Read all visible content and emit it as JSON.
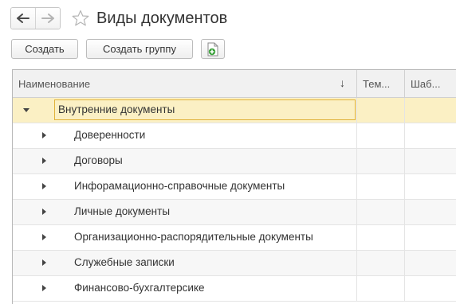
{
  "header": {
    "title": "Виды документов",
    "back_icon": "arrow-left-icon",
    "forward_icon": "arrow-right-icon",
    "favorite_icon": "star-outline-icon"
  },
  "toolbar": {
    "create_label": "Создать",
    "create_group_label": "Создать группу",
    "add_icon": "document-add-icon"
  },
  "table": {
    "columns": {
      "name": "Наименование",
      "tem": "Тем...",
      "shab": "Шаб..."
    },
    "sort_indicator": "↓",
    "root": {
      "label": "Внутренние документы",
      "expanded": true
    },
    "rows": [
      {
        "label": "Доверенности",
        "expanded": false
      },
      {
        "label": "Договоры",
        "expanded": false
      },
      {
        "label": "Инфорамационно-справочные документы",
        "expanded": false
      },
      {
        "label": "Личные документы",
        "expanded": false
      },
      {
        "label": "Организационно-распорядительные документы",
        "expanded": false
      },
      {
        "label": "Служебные записки",
        "expanded": false
      },
      {
        "label": "Финансово-бухгалтерсике",
        "expanded": false
      }
    ]
  },
  "colors": {
    "selection_fill": "#fbf0c4",
    "selection_border": "#e0b23a",
    "add_icon_green": "#3aa13a"
  }
}
